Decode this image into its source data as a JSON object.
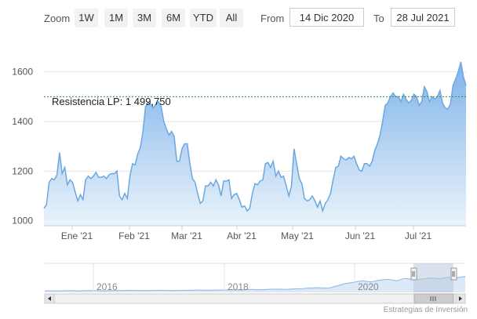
{
  "zoom": {
    "label": "Zoom",
    "buttons": [
      "1W",
      "1M",
      "3M",
      "6M",
      "YTD",
      "All"
    ]
  },
  "range": {
    "from_label": "From",
    "from_value": "14 Dic 2020",
    "to_label": "To",
    "to_value": "28 Jul 2021"
  },
  "credit": "Estrategias de Inversión",
  "colors": {
    "line": "#6aa8e0",
    "fill_top": "#7fb3ea",
    "fill_bottom": "#eaf3fc",
    "resistance": "#2e8b2e",
    "grid": "#e6e6e6",
    "navigator_fill": "#cfe0f3",
    "navigator_line": "#8ab4e6",
    "navigator_mask": "#b8c8dc"
  },
  "chart_data": {
    "type": "area",
    "title": "",
    "xlabel": "",
    "ylabel": "",
    "ylim": [
      980,
      1700
    ],
    "yticks": [
      1000,
      1200,
      1400,
      1600
    ],
    "grid": true,
    "x_tick_labels": [
      "Ene '21",
      "Feb '21",
      "Mar '21",
      "Abr '21",
      "May '21",
      "Jun '21",
      "Jul '21"
    ],
    "series": [
      {
        "values": [
          1050,
          1065,
          1155,
          1170,
          1165,
          1185,
          1275,
          1190,
          1215,
          1145,
          1165,
          1155,
          1115,
          1080,
          1105,
          1085,
          1165,
          1180,
          1170,
          1180,
          1195,
          1175,
          1175,
          1180,
          1170,
          1185,
          1190,
          1190,
          1200,
          1100,
          1085,
          1110,
          1090,
          1180,
          1230,
          1225,
          1270,
          1295,
          1360,
          1460,
          1475,
          1470,
          1455,
          1470,
          1480,
          1460,
          1400,
          1370,
          1345,
          1360,
          1340,
          1240,
          1240,
          1290,
          1310,
          1310,
          1230,
          1170,
          1155,
          1110,
          1070,
          1080,
          1140,
          1140,
          1155,
          1140,
          1165,
          1145,
          1100,
          1160,
          1160,
          1165,
          1090,
          1105,
          1110,
          1085,
          1055,
          1060,
          1040,
          1050,
          1110,
          1150,
          1145,
          1160,
          1165,
          1230,
          1235,
          1215,
          1240,
          1180,
          1200,
          1175,
          1180,
          1140,
          1100,
          1140,
          1290,
          1230,
          1170,
          1150,
          1090,
          1080,
          1085,
          1100,
          1080,
          1055,
          1080,
          1040,
          1070,
          1085,
          1110,
          1165,
          1215,
          1220,
          1260,
          1250,
          1245,
          1255,
          1250,
          1260,
          1230,
          1205,
          1200,
          1230,
          1230,
          1220,
          1240,
          1285,
          1310,
          1345,
          1400,
          1465,
          1475,
          1500,
          1515,
          1500,
          1500,
          1480,
          1510,
          1490,
          1475,
          1485,
          1510,
          1500,
          1465,
          1480,
          1540,
          1520,
          1480,
          1500,
          1490,
          1500,
          1525,
          1475,
          1455,
          1450,
          1470,
          1545,
          1570,
          1600,
          1640,
          1580,
          1545
        ]
      }
    ],
    "annotations": [
      {
        "type": "horizontal-line",
        "value": 1499.75,
        "label": "Resistencia LP: 1 499,750"
      }
    ],
    "navigator": {
      "x_tick_labels": [
        "2016",
        "2018",
        "2020"
      ],
      "values": [
        0.05,
        0.05,
        0.05,
        0.06,
        0.05,
        0.06,
        0.06,
        0.05,
        0.06,
        0.06,
        0.07,
        0.06,
        0.06,
        0.07,
        0.07,
        0.06,
        0.07,
        0.07,
        0.08,
        0.07,
        0.08,
        0.08,
        0.09,
        0.08,
        0.1,
        0.09,
        0.1,
        0.11,
        0.1,
        0.12,
        0.13,
        0.15,
        0.16,
        0.14,
        0.22,
        0.3,
        0.35,
        0.4,
        0.36,
        0.42,
        0.45,
        0.4,
        0.48,
        0.44,
        0.46,
        0.5,
        0.47,
        0.52,
        0.5,
        0.55
      ],
      "selected_range": [
        "14 Dic 2020",
        "28 Jul 2021"
      ]
    }
  }
}
